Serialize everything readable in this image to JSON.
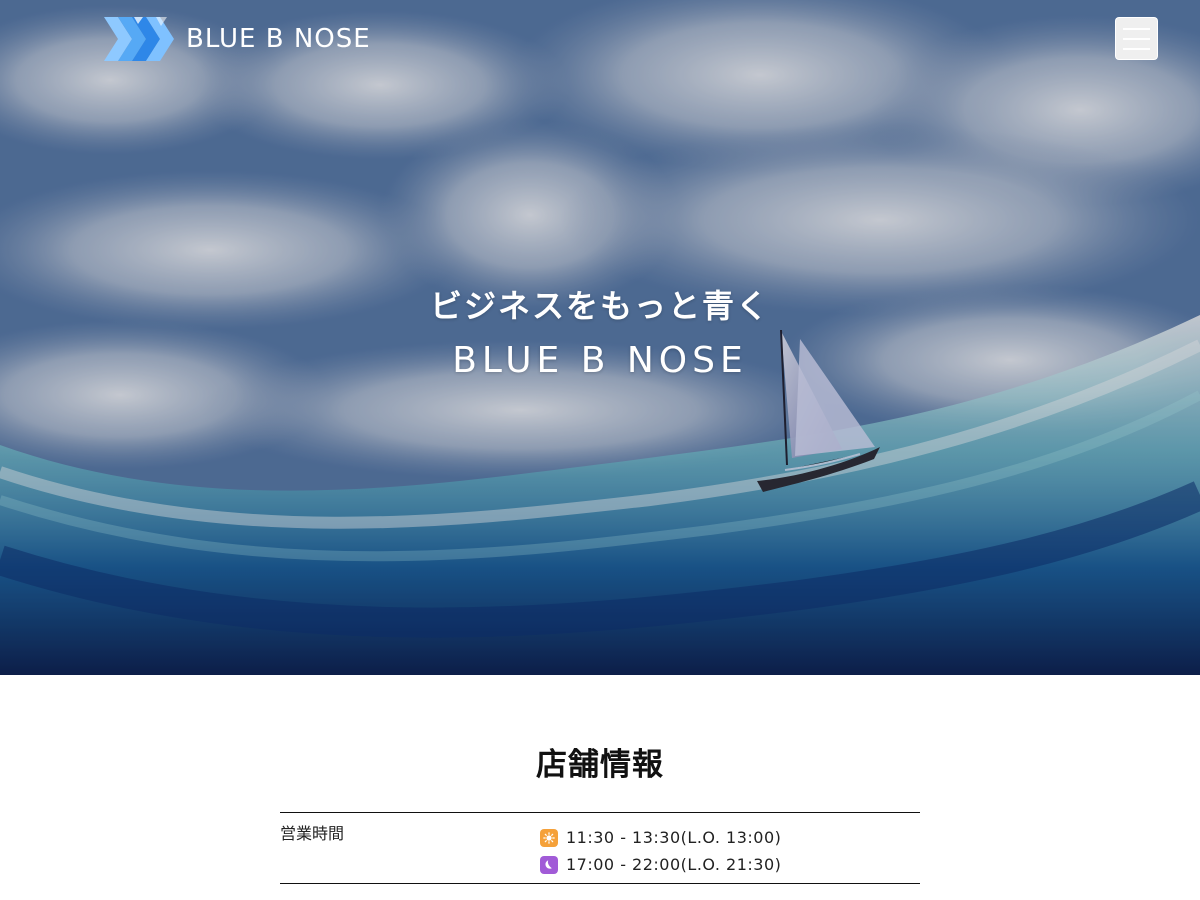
{
  "colors": {
    "header_text": "#ffffff",
    "lunch_icon": "#f5a13a",
    "dinner_icon": "#a15bd7",
    "section_text": "#111111"
  },
  "header": {
    "brand": "BLUE B NOSE",
    "logo_icon": "blue-b-nose-logo-icon",
    "menu_icon": "hamburger-menu-icon"
  },
  "hero": {
    "tagline": "ビジネスをもっと青く",
    "brand": "BLUE B NOSE",
    "image_icon": "sailboat-ocean-sky-photo"
  },
  "store_info": {
    "title": "店舗情報",
    "rows": [
      {
        "label": "営業時間",
        "hours": [
          {
            "icon": "sun-icon",
            "value": "11:30 - 13:30(L.O. 13:00)"
          },
          {
            "icon": "moon-icon",
            "value": "17:00 - 22:00(L.O. 21:30)"
          }
        ]
      }
    ]
  }
}
